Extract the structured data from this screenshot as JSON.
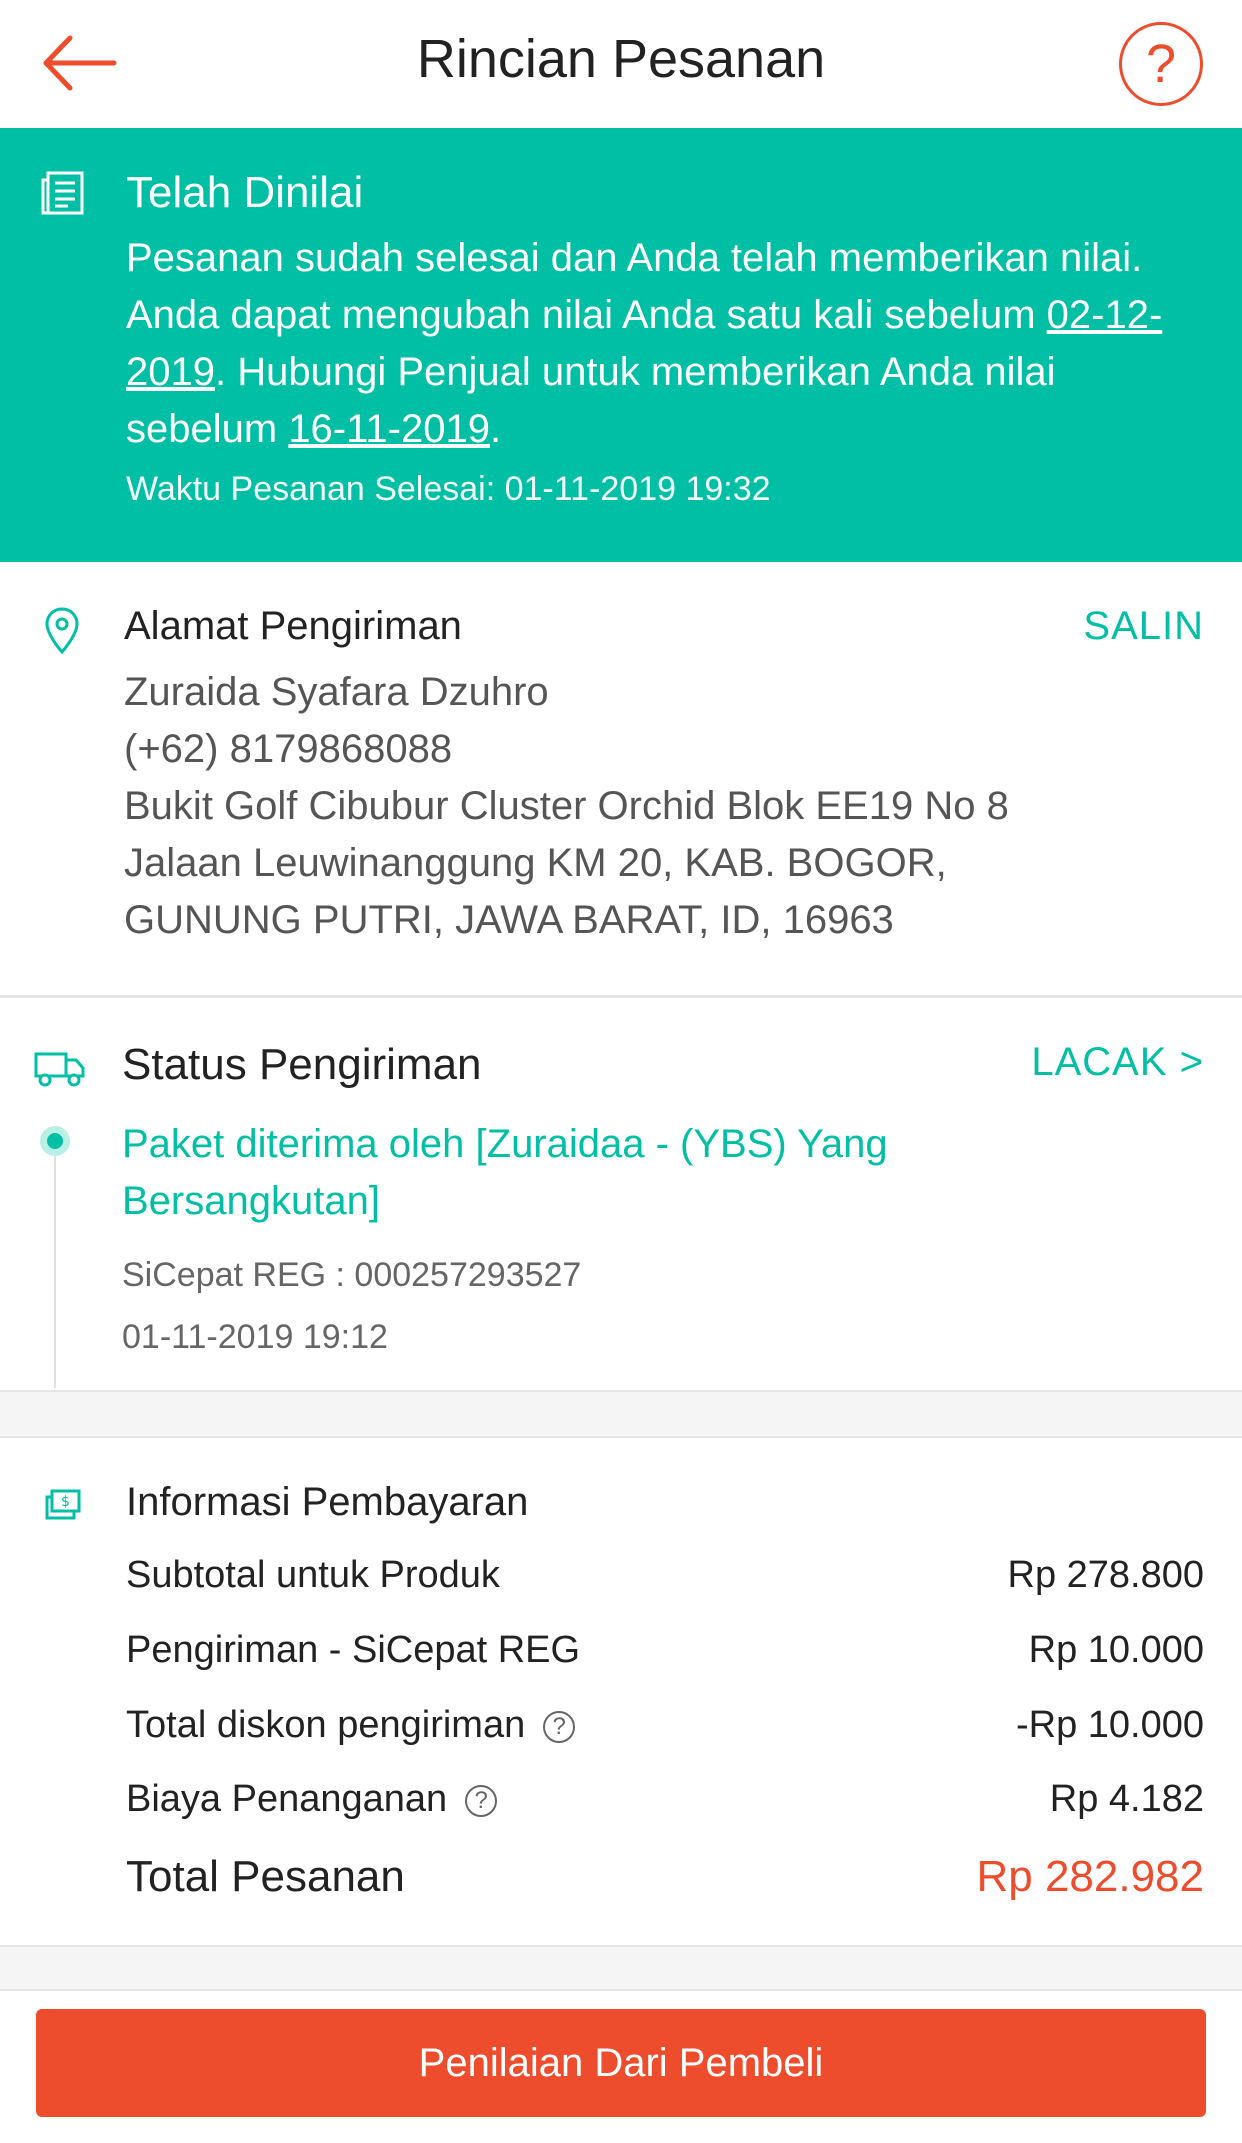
{
  "header": {
    "title": "Rincian Pesanan",
    "help_label": "?"
  },
  "banner": {
    "title": "Telah Dinilai",
    "body_part1": "Pesanan sudah selesai dan Anda telah memberikan nilai. Anda dapat mengubah nilai Anda satu kali sebelum ",
    "date1": "02-12-2019",
    "body_part2": ". Hubungi Penjual untuk memberikan Anda nilai sebelum ",
    "date2": "16-11-2019",
    "body_part3": ".",
    "completed_time": "Waktu Pesanan Selesai: 01-11-2019 19:32"
  },
  "address": {
    "title": "Alamat Pengiriman",
    "copy_label": "SALIN",
    "name": "Zuraida Syafara Dzuhro",
    "phone": "(+62) 8179868088",
    "line1": "Bukit Golf Cibubur Cluster Orchid Blok EE19 No 8",
    "line2": "Jalaan Leuwinanggung KM 20, KAB. BOGOR,",
    "line3": "GUNUNG PUTRI, JAWA BARAT, ID, 16963"
  },
  "shipping": {
    "title": "Status Pengiriman",
    "track_label": "LACAK >",
    "event": "Paket diterima oleh [Zuraidaa - (YBS) Yang Bersangkutan]",
    "courier": "SiCepat REG :  000257293527",
    "date": "01-11-2019 19:12"
  },
  "payment": {
    "title": "Informasi Pembayaran",
    "rows": [
      {
        "label": "Subtotal untuk Produk",
        "value": "Rp 278.800"
      },
      {
        "label": "Pengiriman - SiCepat REG",
        "value": "Rp 10.000"
      },
      {
        "label": "Total diskon pengiriman",
        "value": "-Rp 10.000"
      },
      {
        "label": "Biaya Penanganan",
        "value": "Rp 4.182"
      }
    ],
    "total_label": "Total Pesanan",
    "total_value": "Rp 282.982"
  },
  "footer": {
    "cta_label": "Penilaian Dari Pembeli"
  },
  "colors": {
    "accent": "#ee4d2d",
    "teal": "#00bfa5"
  }
}
